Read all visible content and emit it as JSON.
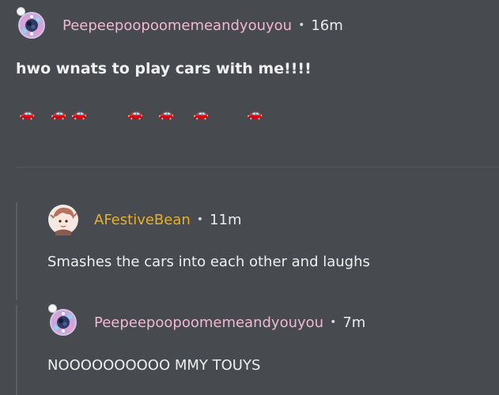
{
  "post": {
    "author": "Peepeepoopoomemeandyouyou",
    "separator": "•",
    "time": "16m",
    "title": "hwo wnats to play cars with me!!!!",
    "cars": [
      "🚗",
      "🚗",
      "🚗",
      "🚗",
      "🚗",
      "🚗",
      "🚗"
    ]
  },
  "comments": [
    {
      "author": "AFestiveBean",
      "separator": "•",
      "time": "11m",
      "body": "Smashes the cars into each other and laughs"
    },
    {
      "author": "Peepeepoopoomemeandyouyou",
      "separator": "•",
      "time": "7m",
      "body": "NOOOOOOOOOO MMY TOUYS"
    }
  ],
  "colors": {
    "background": "#474a4f",
    "username_pink": "#f1b8d3",
    "username_orange": "#e8b029",
    "car_red": "#e23b3b"
  }
}
